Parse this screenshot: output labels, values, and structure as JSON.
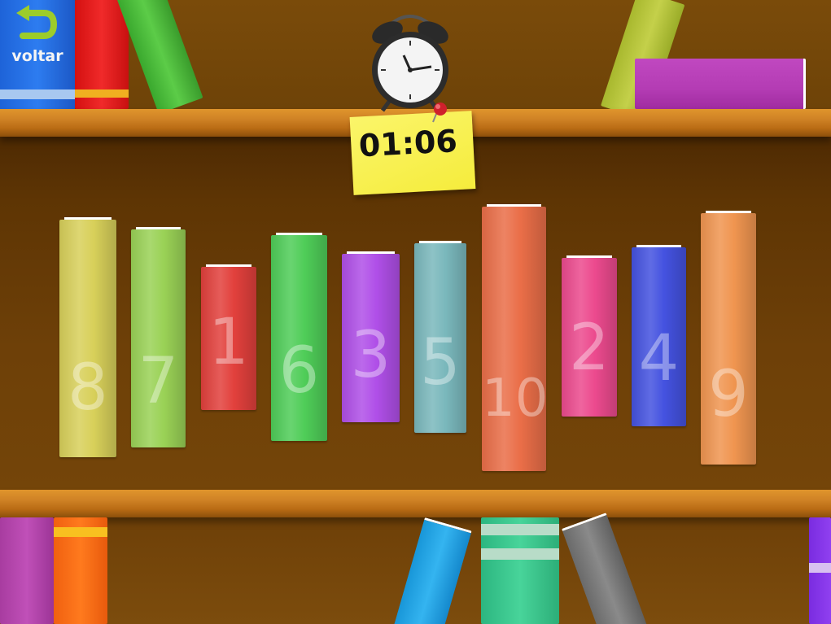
{
  "back_button": {
    "label": "voltar"
  },
  "timer": {
    "value": "01:06"
  },
  "books": [
    {
      "number": "8",
      "color": "#d8d05a"
    },
    {
      "number": "7",
      "color": "#9ad256"
    },
    {
      "number": "1",
      "color": "#e2403c"
    },
    {
      "number": "6",
      "color": "#4fcd58"
    },
    {
      "number": "3",
      "color": "#b04fe8"
    },
    {
      "number": "5",
      "color": "#7ab8bc"
    },
    {
      "number": "10",
      "color": "#ea6e48"
    },
    {
      "number": "2",
      "color": "#ec4a8e"
    },
    {
      "number": "4",
      "color": "#4452e0"
    },
    {
      "number": "9",
      "color": "#f09550"
    }
  ]
}
